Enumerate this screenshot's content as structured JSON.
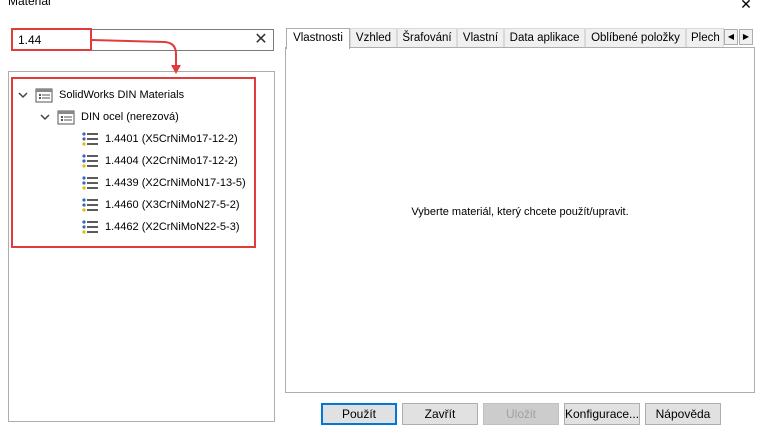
{
  "window": {
    "title": "Material"
  },
  "search": {
    "value": "1.44"
  },
  "tree": {
    "root": {
      "label": "SolidWorks DIN Materials",
      "icon": "library-icon"
    },
    "category": {
      "label": "DIN ocel (nerezová)",
      "icon": "folder-list-icon"
    },
    "items": [
      {
        "label": "1.4401 (X5CrNiMo17-12-2)"
      },
      {
        "label": "1.4404 (X2CrNiMo17-12-2)"
      },
      {
        "label": "1.4439 (X2CrNiMoN17-13-5)"
      },
      {
        "label": "1.4460 (X3CrNiMoN27-5-2)"
      },
      {
        "label": "1.4462 (X2CrNiMoN22-5-3)"
      }
    ]
  },
  "tabs": [
    {
      "label": "Vlastnosti",
      "active": true
    },
    {
      "label": "Vzhled"
    },
    {
      "label": "Šrafování"
    },
    {
      "label": "Vlastní"
    },
    {
      "label": "Data aplikace"
    },
    {
      "label": "Oblíbené položky"
    },
    {
      "label": "Plech"
    }
  ],
  "content": {
    "message": "Vyberte materiál, který chcete použít/upravit."
  },
  "buttons": {
    "apply": "Použít",
    "close": "Zavřít",
    "save": "Uložit",
    "config": "Konfigurace...",
    "help": "Nápověda"
  },
  "colors": {
    "highlight": "#e03c3c",
    "accent": "#0078d7"
  }
}
